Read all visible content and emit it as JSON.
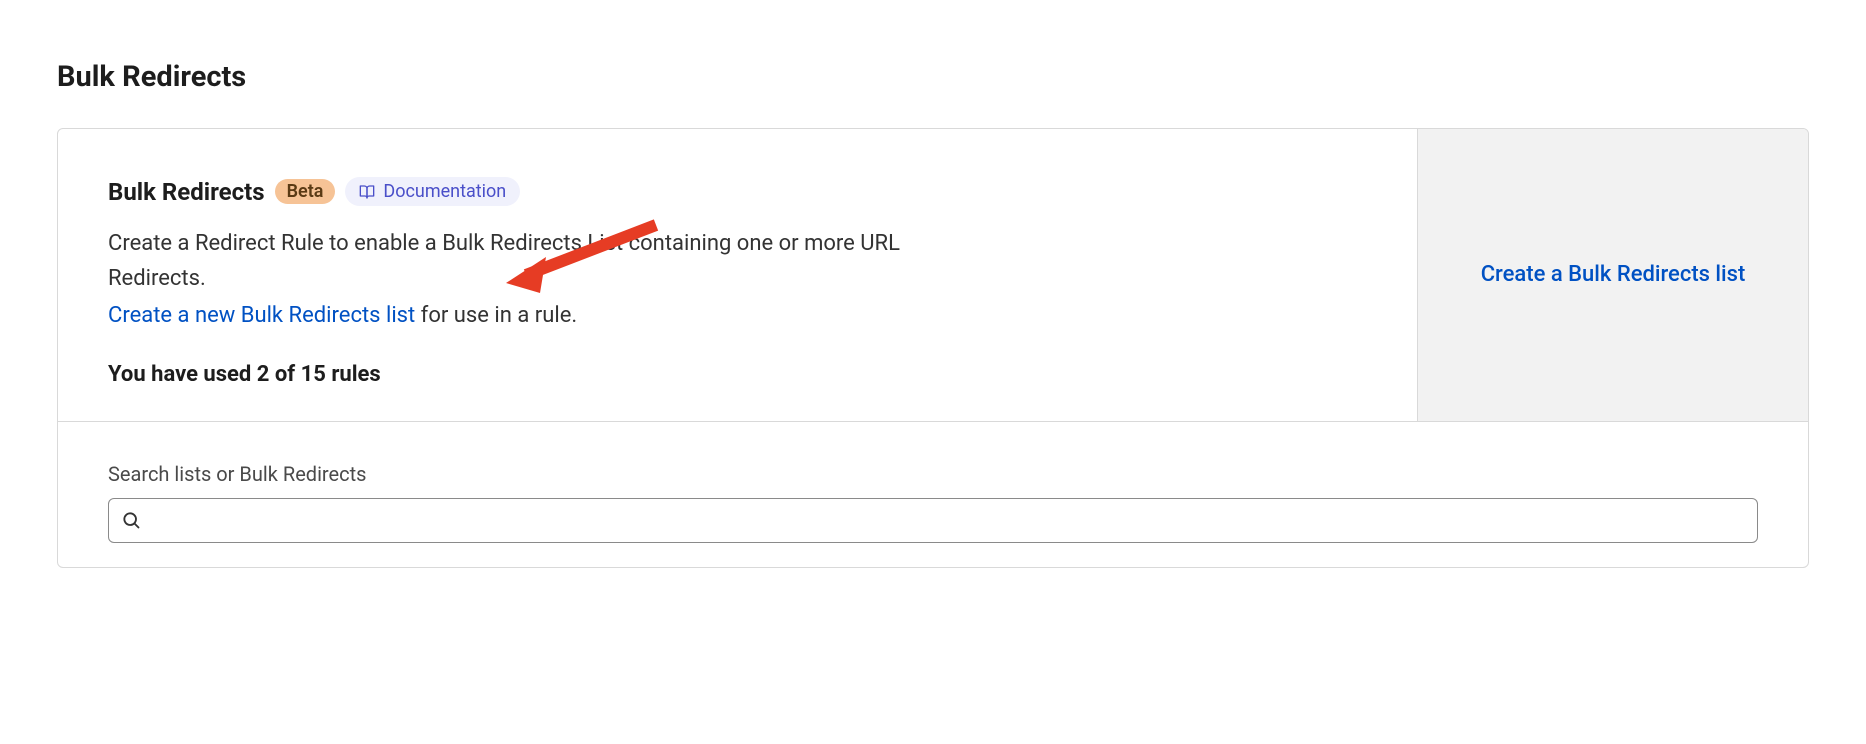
{
  "page": {
    "title": "Bulk Redirects"
  },
  "card": {
    "header": {
      "title": "Bulk Redirects",
      "badge": "Beta",
      "documentation_label": "Documentation"
    },
    "description": "Create a Redirect Rule to enable a Bulk Redirects List containing one or more URL Redirects.",
    "create_link_text": "Create a new Bulk Redirects list",
    "create_link_suffix": " for use in a rule.",
    "usage_text": "You have used 2 of 15 rules",
    "side_action": "Create a Bulk Redirects list"
  },
  "search": {
    "label": "Search lists or Bulk Redirects",
    "value": ""
  },
  "colors": {
    "link": "#0051c3",
    "badge_bg": "#f6c396",
    "doc_bg": "#f0f1fc",
    "side_bg": "#f2f2f2",
    "border": "#d9d9d9",
    "arrow": "#e63c24"
  }
}
